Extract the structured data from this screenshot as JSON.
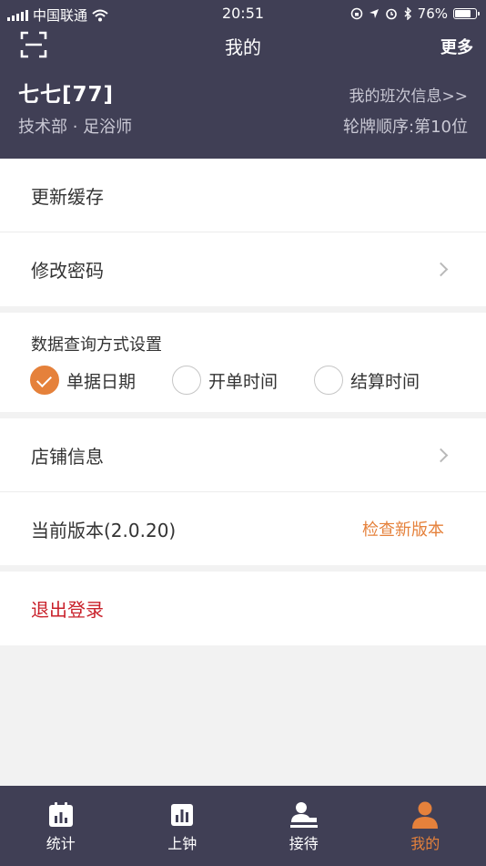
{
  "status_bar": {
    "carrier": "中国联通",
    "time": "20:51",
    "battery": "76%",
    "battery_level": 0.76
  },
  "header": {
    "title": "我的",
    "more_label": "更多",
    "user_name": "七七[77]",
    "department": "技术部 · 足浴师",
    "shift_link": "我的班次信息>>",
    "queue_order": "轮牌顺序:第10位"
  },
  "menu": {
    "refresh_cache": "更新缓存",
    "change_password": "修改密码",
    "store_info": "店铺信息",
    "current_version": "当前版本(2.0.20)",
    "check_update": "检查新版本",
    "logout": "退出登录"
  },
  "query_settings": {
    "title": "数据查询方式设置",
    "options": [
      {
        "label": "单据日期",
        "checked": true
      },
      {
        "label": "开单时间",
        "checked": false
      },
      {
        "label": "结算时间",
        "checked": false
      }
    ]
  },
  "tabbar": {
    "tabs": [
      {
        "label": "统计",
        "icon": "stats-icon",
        "active": false
      },
      {
        "label": "上钟",
        "icon": "bar-chart-icon",
        "active": false
      },
      {
        "label": "接待",
        "icon": "reception-icon",
        "active": false
      },
      {
        "label": "我的",
        "icon": "person-icon",
        "active": true
      }
    ]
  },
  "colors": {
    "header_bg": "#403f55",
    "accent": "#e5813b",
    "logout": "#c9202a"
  }
}
